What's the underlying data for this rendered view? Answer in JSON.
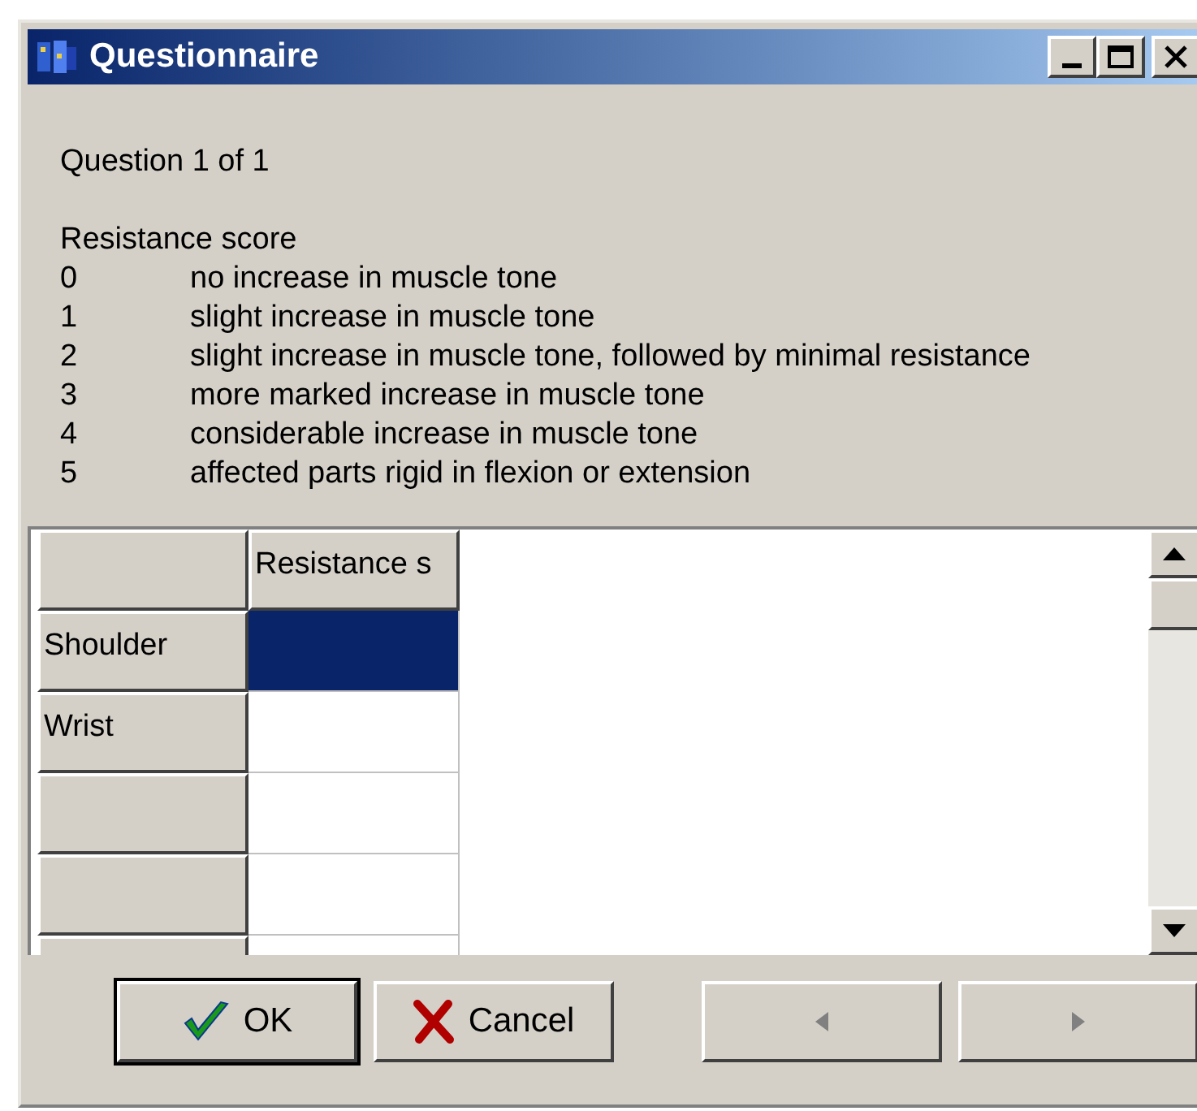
{
  "window": {
    "title": "Questionnaire"
  },
  "question_counter": "Question 1 of 1",
  "scale": {
    "title": "Resistance score",
    "items": [
      {
        "score": "0",
        "description": "no increase in muscle tone"
      },
      {
        "score": "1",
        "description": "slight increase in muscle tone"
      },
      {
        "score": "2",
        "description": "slight increase in muscle tone, followed by minimal resistance"
      },
      {
        "score": "3",
        "description": "more marked increase in muscle tone"
      },
      {
        "score": "4",
        "description": "considerable increase in muscle tone"
      },
      {
        "score": "5",
        "description": "affected parts rigid in flexion or extension"
      }
    ]
  },
  "grid": {
    "columns": [
      "Resistance s"
    ],
    "rows": [
      {
        "header": "Shoulder",
        "selected": true
      },
      {
        "header": "Wrist",
        "selected": false
      },
      {
        "selected": false
      },
      {
        "selected": false
      },
      {
        "selected": false
      }
    ]
  },
  "buttons": [
    {
      "kind": "ok",
      "label": "OK",
      "disabled": false
    },
    {
      "kind": "cancel",
      "label": "Cancel",
      "disabled": false
    },
    {
      "kind": "prev",
      "disabled": true
    },
    {
      "kind": "next",
      "disabled": true
    }
  ]
}
